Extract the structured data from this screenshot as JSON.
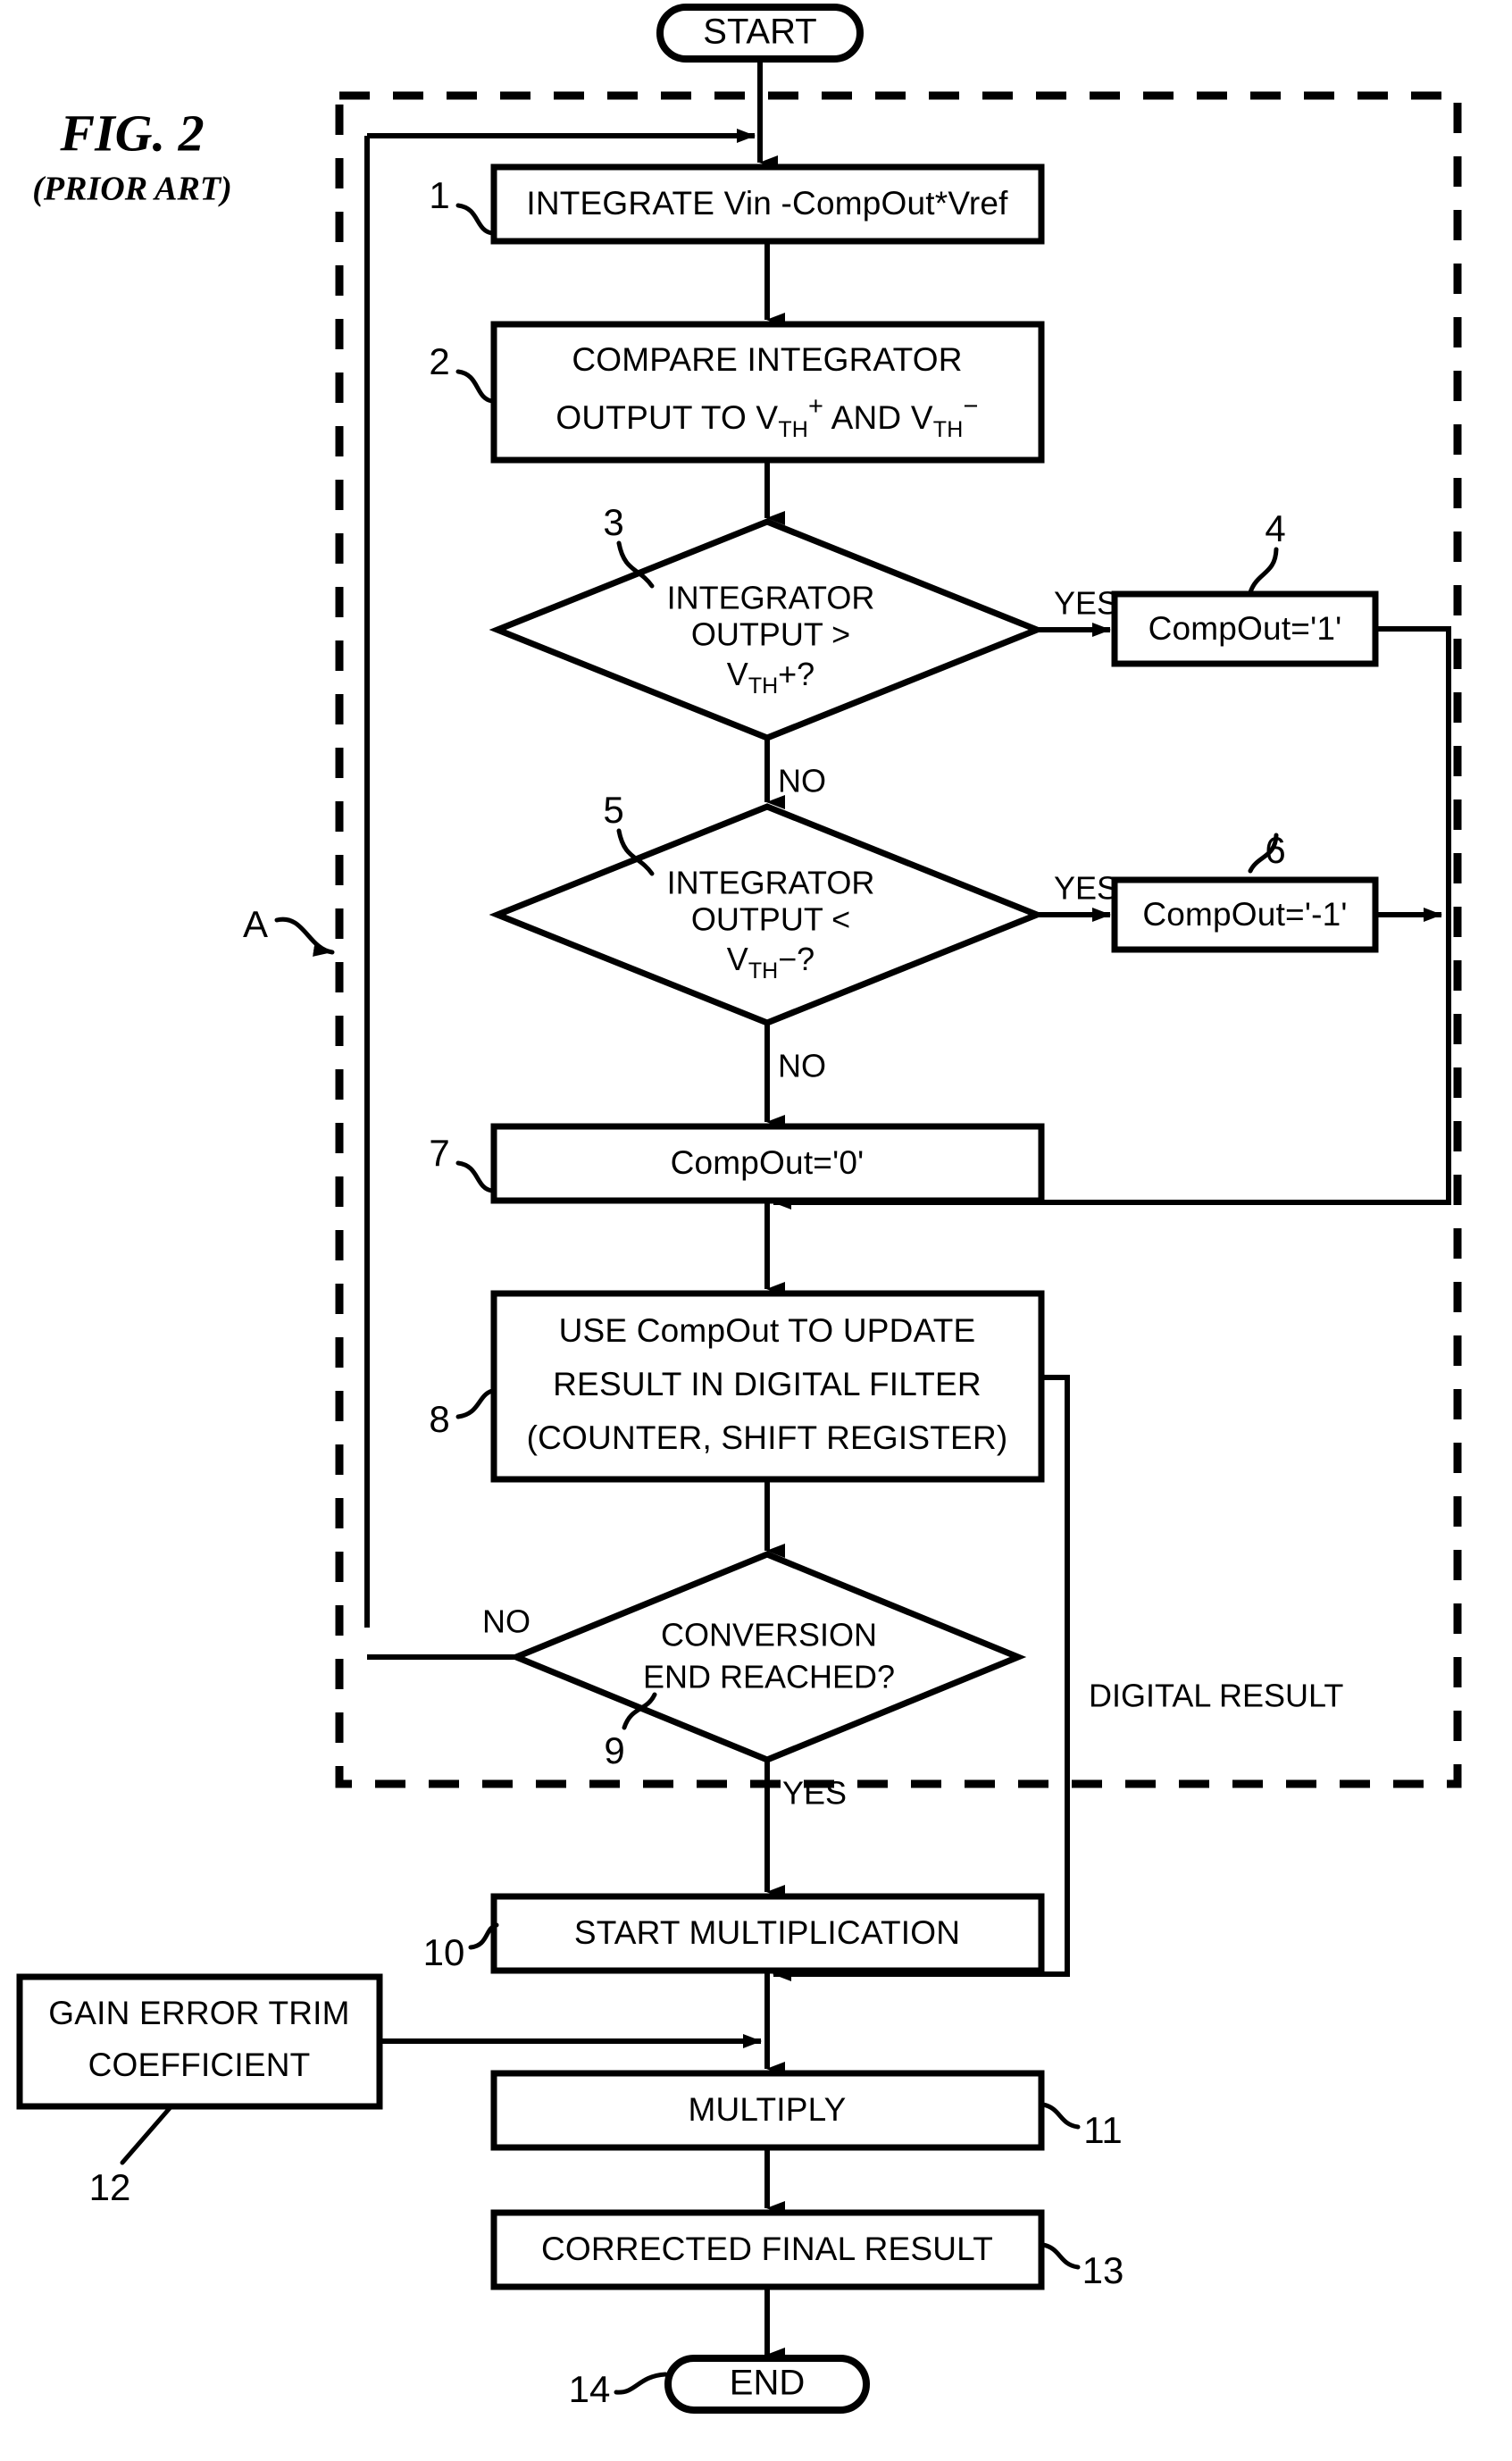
{
  "figure": {
    "title": "FIG. 2",
    "subtitle": "(PRIOR ART)",
    "domain_note": "patent flowchart"
  },
  "colors": {
    "stroke": "#000000",
    "fill": "#ffffff",
    "background": "#ffffff"
  },
  "terminals": {
    "start": {
      "label": "START",
      "ref": ""
    },
    "end": {
      "label": "END",
      "ref": "14"
    }
  },
  "nodes": [
    {
      "ref": "1",
      "type": "process",
      "lines": [
        "INTEGRATE Vin -CompOut*Vref"
      ]
    },
    {
      "ref": "2",
      "type": "process",
      "lines": [
        "COMPARE INTEGRATOR",
        "OUTPUT TO V",
        "TH",
        "+",
        " AND V",
        "TH",
        "−"
      ],
      "line1": "COMPARE INTEGRATOR",
      "line2_pre": "OUTPUT TO V",
      "line2_sub1": "TH",
      "line2_sup1": "+",
      "line2_mid": " AND V",
      "line2_sub2": "TH",
      "line2_sup2": "−"
    },
    {
      "ref": "3",
      "type": "decision",
      "line1": "INTEGRATOR",
      "line2": "OUTPUT >",
      "line3_pre": "V",
      "line3_sub": "TH",
      "line3_post": "+?",
      "yes_label": "YES",
      "no_label": "NO"
    },
    {
      "ref": "4",
      "type": "process",
      "lines": [
        "CompOut='1'"
      ]
    },
    {
      "ref": "5",
      "type": "decision",
      "line1": "INTEGRATOR",
      "line2": "OUTPUT <",
      "line3_pre": "V",
      "line3_sub": "TH",
      "line3_post": "−?",
      "yes_label": "YES",
      "no_label": "NO"
    },
    {
      "ref": "6",
      "type": "process",
      "lines": [
        "CompOut='-1'"
      ]
    },
    {
      "ref": "7",
      "type": "process",
      "lines": [
        "CompOut='0'"
      ]
    },
    {
      "ref": "8",
      "type": "process",
      "lines": [
        "USE CompOut TO UPDATE",
        "RESULT IN DIGITAL FILTER",
        "(COUNTER, SHIFT REGISTER)"
      ]
    },
    {
      "ref": "9",
      "type": "decision",
      "line1": "CONVERSION",
      "line2": "END REACHED?",
      "yes_label": "YES",
      "no_label": "NO"
    },
    {
      "ref": "10",
      "type": "process",
      "lines": [
        "START MULTIPLICATION"
      ]
    },
    {
      "ref": "11",
      "type": "process",
      "lines": [
        "MULTIPLY"
      ]
    },
    {
      "ref": "12",
      "type": "process",
      "lines": [
        "GAIN ERROR TRIM",
        "COEFFICIENT"
      ]
    },
    {
      "ref": "13",
      "type": "process",
      "lines": [
        "CORRECTED FINAL RESULT"
      ]
    }
  ],
  "annotations": {
    "boundary_ref": "A",
    "digital_result": "DIGITAL RESULT"
  },
  "edge_labels": {
    "yes": "YES",
    "no": "NO"
  }
}
